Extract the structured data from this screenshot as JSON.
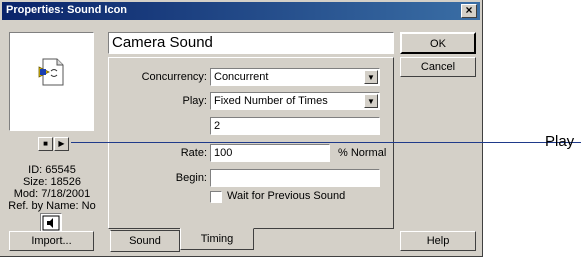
{
  "window": {
    "title": "Properties: Sound Icon",
    "close_glyph": "×"
  },
  "buttons": {
    "ok": "OK",
    "cancel": "Cancel",
    "help": "Help",
    "import": "Import..."
  },
  "playback": {
    "stop_glyph": "■",
    "play_glyph": "▶"
  },
  "info": {
    "id": "ID: 65545",
    "size": "Size: 18526",
    "mod": "Mod: 7/18/2001",
    "ref": "Ref. by Name: No"
  },
  "name_value": "Camera Sound",
  "form": {
    "concurrency_label": "Concurrency:",
    "concurrency_value": "Concurrent",
    "play_label": "Play:",
    "play_value": "Fixed Number of Times",
    "times_value": "2",
    "rate_label": "Rate:",
    "rate_value": "100",
    "rate_unit": "% Normal",
    "begin_label": "Begin:",
    "begin_value": "",
    "wait_label": "Wait for Previous Sound"
  },
  "tabs": [
    "Sound",
    "Timing"
  ],
  "callout": "Play",
  "icons": {
    "preview": "sound-file-icon",
    "small": "sound-icon"
  }
}
